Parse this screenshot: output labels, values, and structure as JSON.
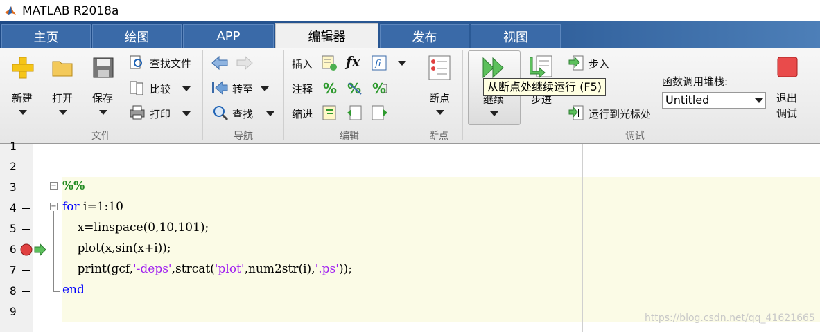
{
  "window": {
    "title": "MATLAB R2018a"
  },
  "tabs": [
    "主页",
    "绘图",
    "APP",
    "编辑器",
    "发布",
    "视图"
  ],
  "ribbon": {
    "file": {
      "new": "新建",
      "open": "打开",
      "save": "保存",
      "find_files": "查找文件",
      "compare": "比较",
      "print": "打印",
      "section": "文件"
    },
    "navigate": {
      "goto": "转至",
      "find": "查找",
      "section": "导航"
    },
    "edit": {
      "insert": "插入",
      "comment": "注释",
      "indent": "缩进",
      "fx": "fx",
      "section": "编辑"
    },
    "breakpoints": {
      "label": "断点",
      "section": "断点"
    },
    "debug": {
      "continue": "继续",
      "step": "步进",
      "step_in": "步入",
      "run_to_cursor": "运行到光标处",
      "stack_label": "函数调用堆栈:",
      "stack_value": "Untitled",
      "quit_line1": "退出",
      "quit_line2": "调试",
      "section": "调试"
    }
  },
  "tooltip": "从断点处继续运行 (F5)",
  "editor": {
    "line_numbers": [
      "1",
      "2",
      "3",
      "4",
      "5",
      "6",
      "7",
      "8",
      "9"
    ],
    "code": {
      "l3": "%%",
      "l4_kw": "for",
      "l4_rest": " i=1:10",
      "l5": "    x=linspace(0,10,101);",
      "l6": "    plot(x,sin(x+i));",
      "l7_a": "    print(gcf,",
      "l7_s1": "'-deps'",
      "l7_b": ",strcat(",
      "l7_s2": "'plot'",
      "l7_c": ",num2str(i),",
      "l7_s3": "'.ps'",
      "l7_d": "));",
      "l8_kw": "end"
    }
  },
  "watermark": "https://blog.csdn.net/qq_41621665",
  "colors": {
    "tab_active": "#f0f0f0",
    "tabbar": "#1e4a86",
    "keyword": "#0000ff",
    "string": "#a020f0",
    "comment": "#228b22",
    "breakpoint": "#e04040"
  }
}
